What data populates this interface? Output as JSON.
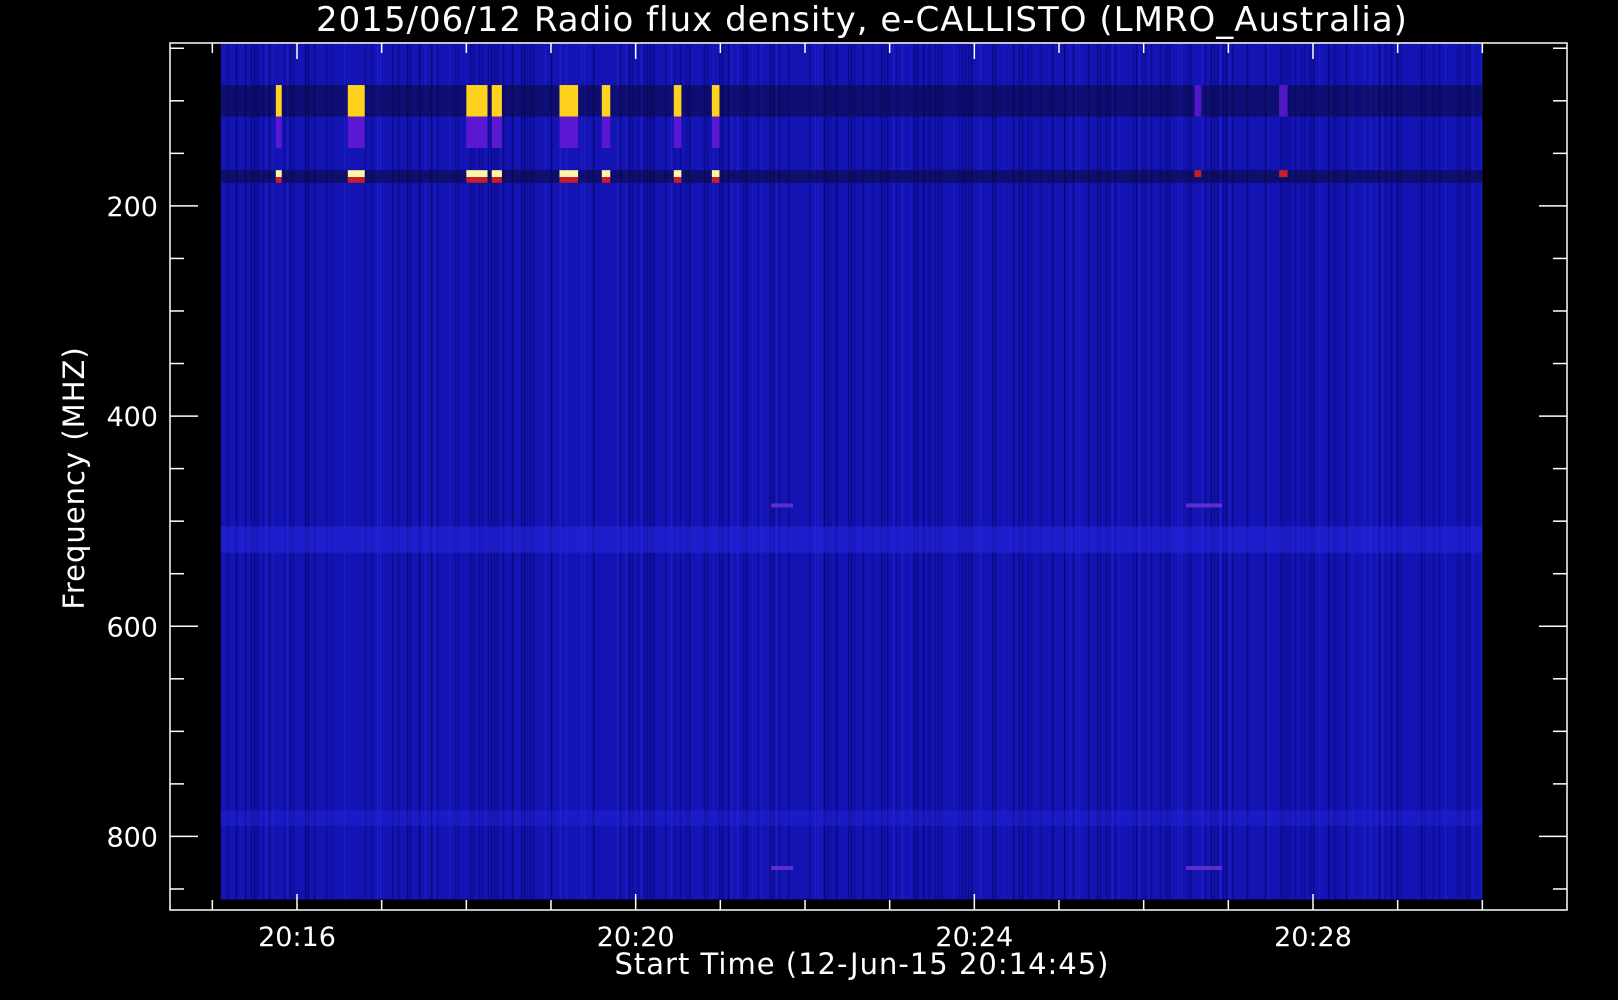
{
  "chart_data": {
    "type": "heatmap",
    "title": "2015/06/12  Radio flux density, e-CALLISTO (LMRO_Australia)",
    "xlabel": "Start Time (12-Jun-15 20:14:45)",
    "ylabel": "Frequency (MHZ)",
    "x_ticks": [
      "20:16",
      "20:20",
      "20:24",
      "20:28"
    ],
    "x_tick_minutes": [
      16,
      20,
      24,
      28
    ],
    "y_ticks": [
      "200",
      "400",
      "600",
      "800"
    ],
    "y_tick_values": [
      200,
      400,
      600,
      800
    ],
    "xlim_minutes": [
      14.5,
      31.0
    ],
    "ylim_mhz": [
      45,
      870
    ],
    "data_extent": {
      "t_start_minutes": 15.1,
      "t_end_minutes": 30.0,
      "f_min_mhz": 45,
      "f_max_mhz": 860
    },
    "y_reversed": true,
    "colors": {
      "background": "#1414b4",
      "burst_strong": "#ffd21e",
      "burst_core": "#fff5aa",
      "burst_mid": "#5a18d2",
      "burst_red": "#c81e28",
      "dark_band": "#0a0a3c"
    },
    "bursts": [
      {
        "t": 15.75,
        "dt": 0.07,
        "intensity": 0.8
      },
      {
        "t": 16.6,
        "dt": 0.2,
        "intensity": 1.0
      },
      {
        "t": 18.0,
        "dt": 0.25,
        "intensity": 1.0
      },
      {
        "t": 18.3,
        "dt": 0.12,
        "intensity": 1.0
      },
      {
        "t": 19.1,
        "dt": 0.22,
        "intensity": 1.0
      },
      {
        "t": 19.6,
        "dt": 0.1,
        "intensity": 1.0
      },
      {
        "t": 20.45,
        "dt": 0.09,
        "intensity": 0.9
      },
      {
        "t": 20.9,
        "dt": 0.09,
        "intensity": 0.9
      },
      {
        "t": 26.6,
        "dt": 0.08,
        "intensity": 0.35
      },
      {
        "t": 27.6,
        "dt": 0.1,
        "intensity": 0.4
      }
    ],
    "bands": {
      "burst_top_mhz": [
        85,
        115
      ],
      "burst_mid_mhz": [
        115,
        145
      ],
      "burst_line_mhz": [
        166,
        178
      ],
      "bright_band_mhz": [
        505,
        530
      ],
      "bright_band2_mhz": [
        775,
        790
      ]
    }
  }
}
